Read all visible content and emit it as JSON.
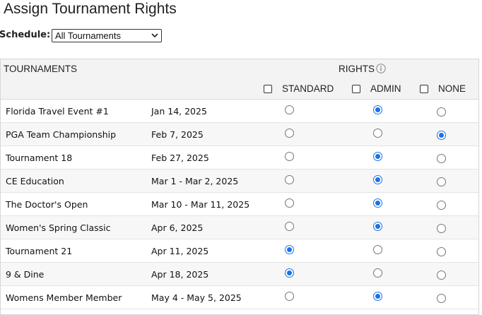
{
  "page": {
    "title": "Assign Tournament Rights"
  },
  "schedule": {
    "label": "Schedule:",
    "selected": "All Tournaments"
  },
  "table": {
    "col_tournaments": "TOURNAMENTS",
    "col_rights": "RIGHTS",
    "rights_options": [
      "STANDARD",
      "ADMIN",
      "NONE"
    ],
    "rows": [
      {
        "name": "Florida Travel Event #1",
        "date": "Jan 14, 2025",
        "right": "ADMIN"
      },
      {
        "name": "PGA Team Championship",
        "date": "Feb 7, 2025",
        "right": "NONE"
      },
      {
        "name": "Tournament 18",
        "date": "Feb 27, 2025",
        "right": "ADMIN"
      },
      {
        "name": "CE Education",
        "date": "Mar 1 - Mar 2, 2025",
        "right": "ADMIN"
      },
      {
        "name": "The Doctor's Open",
        "date": "Mar 10 - Mar 11, 2025",
        "right": "ADMIN"
      },
      {
        "name": "Women's Spring Classic",
        "date": "Apr 6, 2025",
        "right": "ADMIN"
      },
      {
        "name": "Tournament 21",
        "date": "Apr 11, 2025",
        "right": "STANDARD"
      },
      {
        "name": "9 & Dine",
        "date": "Apr 18, 2025",
        "right": "STANDARD"
      },
      {
        "name": "Womens Member Member",
        "date": "May 4 - May 5, 2025",
        "right": "ADMIN"
      }
    ]
  },
  "colors": {
    "accent": "#1a73e8",
    "header_bg": "#f3f3f3"
  }
}
